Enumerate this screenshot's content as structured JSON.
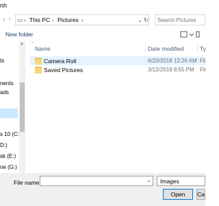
{
  "window": {
    "title": "nh"
  },
  "address": {
    "crumbs": [
      "This PC",
      "Pictures"
    ],
    "separator": "›"
  },
  "search": {
    "placeholder": "Search Pictures"
  },
  "toolbar": {
    "new_folder": "New folder"
  },
  "nav_pane": {
    "items": [
      {
        "label": "ts"
      },
      {
        "label": "nents"
      },
      {
        "label": "ads"
      },
      {
        "label": "s 10 (C:)"
      },
      {
        "label": "D:)"
      },
      {
        "label": "sk (E:)"
      },
      {
        "label": "ne (G:)"
      }
    ]
  },
  "columns": {
    "name": "Name",
    "date": "Date modified",
    "type": "Ty"
  },
  "files": [
    {
      "name": "Camera Roll",
      "date": "6/20/2018 12:26 AM",
      "type": "Fil",
      "selected": true
    },
    {
      "name": "Saved Pictures",
      "date": "3/12/2019 8:55 PM",
      "type": "Fil",
      "selected": false
    }
  ],
  "bottom": {
    "file_name_label": "File name:",
    "file_name_value": "",
    "filter": "Images",
    "open_label": "Open",
    "cancel_label": "Ca"
  },
  "colors": {
    "selection": "#cce8ff",
    "hover_row": "#e5f3ff",
    "folder": "#f4d77a",
    "accent": "#0078d7"
  }
}
